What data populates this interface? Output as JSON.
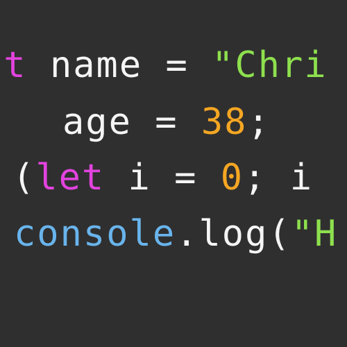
{
  "code": {
    "line1": {
      "kw": "st",
      "sp1": " ",
      "ident": "name",
      "op": " = ",
      "str": "\"Chri"
    },
    "line2": {
      "ident": "age",
      "op": " = ",
      "num": "38",
      "punc": ";"
    },
    "line3": {
      "paren": "(",
      "kw": "let",
      "ident": " i ",
      "op": "=",
      "sp": " ",
      "num": "0",
      "rest": "; i"
    },
    "line4": {
      "obj": "console",
      "dot": ".",
      "fn": "log",
      "paren": "(",
      "str": "\"H"
    }
  },
  "colors": {
    "background": "#2f2f2f",
    "keyword": "#e243de",
    "identifier": "#f5f5f5",
    "string": "#8ee04e",
    "number": "#f5a623",
    "function": "#69b4ec"
  }
}
